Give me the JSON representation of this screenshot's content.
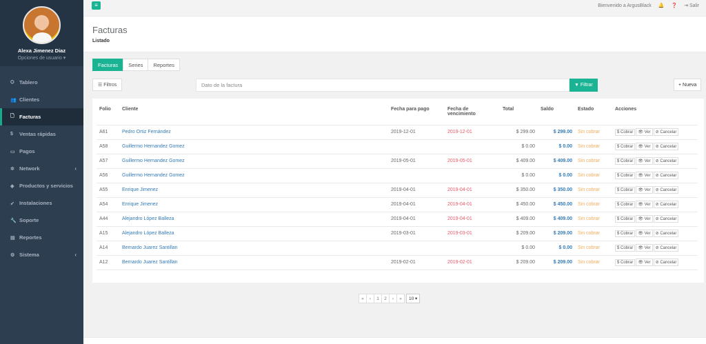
{
  "user": {
    "name": "Alexa Jimenez Diaz",
    "options": "Opciones de usuario ▾"
  },
  "sidebar": {
    "items": [
      {
        "icon": "⛭",
        "label": "Tablero"
      },
      {
        "icon": "👥",
        "label": "Clientes"
      },
      {
        "icon": "🗋",
        "label": "Facturas"
      },
      {
        "icon": "$",
        "label": "Ventas rápidas"
      },
      {
        "icon": "▭",
        "label": "Pagos"
      },
      {
        "icon": "✲",
        "label": "Network",
        "chevron": "‹"
      },
      {
        "icon": "◈",
        "label": "Productos y servicios"
      },
      {
        "icon": "➹",
        "label": "Instalaciones"
      },
      {
        "icon": "🔧",
        "label": "Soporte"
      },
      {
        "icon": "▤",
        "label": "Reportes"
      },
      {
        "icon": "⚙",
        "label": "Sistema",
        "chevron": "‹"
      }
    ]
  },
  "topbar": {
    "menu_icon": "≡",
    "welcome": "Bienvenido a ArgusBlack",
    "bell": "🔔",
    "help": "❓",
    "logout": "⇥ Salir"
  },
  "page": {
    "title": "Facturas",
    "subtitle": "Listado"
  },
  "tabs": [
    "Facturas",
    "Series",
    "Reportes"
  ],
  "filters": {
    "filtros_label": "☰ Filtros",
    "search_placeholder": "Dato de la factura",
    "filtrar_label": "▼ Filtrar",
    "nueva_label": "+ Nueva"
  },
  "table": {
    "headers": [
      "Folio",
      "Cliente",
      "Fecha para pago",
      "Fecha de vencimiento",
      "Total",
      "Saldo",
      "Estado",
      "Acciones"
    ],
    "rows": [
      {
        "folio": "A61",
        "cliente": "Pedro Ortiz Fernández",
        "pago": "2019-12-01",
        "venc": "2019-12-01",
        "total": "$ 299.00",
        "saldo": "$ 299.00",
        "estado": "Sin cobrar"
      },
      {
        "folio": "A58",
        "cliente": "Guillermo Hernandez Gomez",
        "pago": "",
        "venc": "",
        "total": "$ 0.00",
        "saldo": "$ 0.00",
        "estado": "Sin cobrar"
      },
      {
        "folio": "A57",
        "cliente": "Guillermo Hernandez Gomez",
        "pago": "2019-05-01",
        "venc": "2019-05-01",
        "total": "$ 409.00",
        "saldo": "$ 409.00",
        "estado": "Sin cobrar"
      },
      {
        "folio": "A56",
        "cliente": "Guillermo Hernandez Gomez",
        "pago": "",
        "venc": "",
        "total": "$ 0.00",
        "saldo": "$ 0.00",
        "estado": "Sin cobrar"
      },
      {
        "folio": "A55",
        "cliente": "Enrique Jimenez",
        "pago": "2019-04-01",
        "venc": "2019-04-01",
        "total": "$ 350.00",
        "saldo": "$ 350.00",
        "estado": "Sin cobrar"
      },
      {
        "folio": "A54",
        "cliente": "Enrique Jimenez",
        "pago": "2019-04-01",
        "venc": "2019-04-01",
        "total": "$ 450.00",
        "saldo": "$ 450.00",
        "estado": "Sin cobrar"
      },
      {
        "folio": "A44",
        "cliente": "Alejandro López Balleza",
        "pago": "2019-04-01",
        "venc": "2019-04-01",
        "total": "$ 409.00",
        "saldo": "$ 409.00",
        "estado": "Sin cobrar"
      },
      {
        "folio": "A15",
        "cliente": "Alejandro López Balleza",
        "pago": "2019-03-01",
        "venc": "2019-03-01",
        "total": "$ 209.00",
        "saldo": "$ 209.00",
        "estado": "Sin cobrar"
      },
      {
        "folio": "A14",
        "cliente": "Bernardo Juarez Santillan",
        "pago": "",
        "venc": "",
        "total": "$ 0.00",
        "saldo": "$ 0.00",
        "estado": "Sin cobrar"
      },
      {
        "folio": "A12",
        "cliente": "Bernardo Juarez Santillan",
        "pago": "2019-02-01",
        "venc": "2019-02-01",
        "total": "$ 209.00",
        "saldo": "$ 209.00",
        "estado": "Sin cobrar"
      }
    ],
    "actions": [
      "$ Cobrar",
      "👁 Ver",
      "⊘ Cancelar"
    ]
  },
  "pagination": {
    "items": [
      "«",
      "‹",
      "1",
      "2",
      "›",
      "»"
    ],
    "page_size": "10 ▾"
  },
  "colors": {
    "sidebar": "#2c3e50",
    "accent": "#1ab394",
    "link": "#337ab7",
    "due": "#ed5565",
    "pending": "#f8ac59"
  }
}
